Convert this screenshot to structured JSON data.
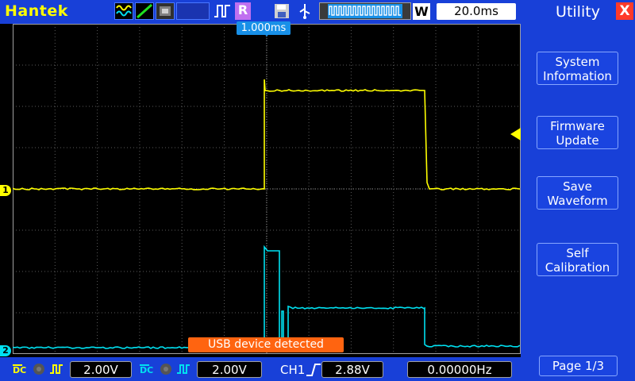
{
  "brand": "Hantek",
  "topbar": {
    "run_state": "R",
    "zoom_label": "W",
    "timebase": "20.0ms",
    "trigger_position": "1.000ms"
  },
  "menu": {
    "title": "Utility",
    "close": "X",
    "items": [
      {
        "label": "System\nInformation"
      },
      {
        "label": "Firmware\nUpdate"
      },
      {
        "label": "Save\nWaveform"
      },
      {
        "label": "Self\nCalibration"
      }
    ],
    "page": "Page 1/3"
  },
  "channels": {
    "ch1": {
      "marker": "1",
      "coupling": "DC",
      "scale": "2.00V",
      "color": "#ffff00"
    },
    "ch2": {
      "marker": "2",
      "coupling": "DC",
      "scale": "2.00V",
      "color": "#00e0f0"
    }
  },
  "trigger": {
    "source": "CH1",
    "level": "2.88V"
  },
  "frequency": "0.00000Hz",
  "notification": "USB device detected",
  "icons": [
    "waveform-icon",
    "edge-icon",
    "memory-icon",
    "trigger-icon",
    "save-icon",
    "usb-icon"
  ]
}
